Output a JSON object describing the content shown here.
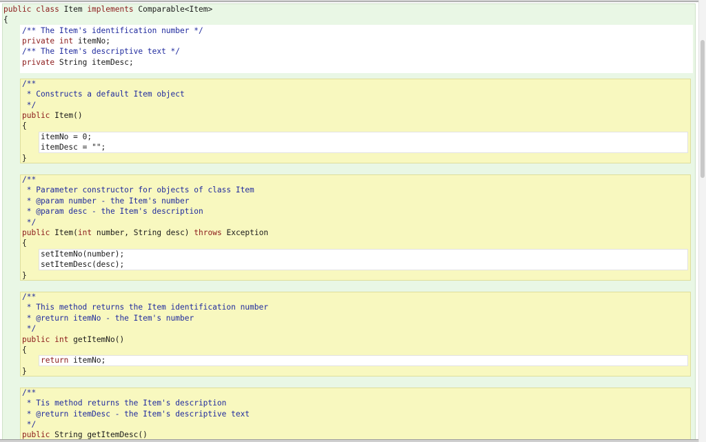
{
  "colors": {
    "keyword": "#8b1a1a",
    "comment": "#1f2a9e",
    "class_bg": "#e9f7e5",
    "method_bg": "#f8f8bf",
    "body_bg": "#ffffff"
  },
  "code": {
    "class_decl_kw1": "public",
    "class_decl_kw2": "class",
    "class_decl_name": "Item",
    "class_decl_kw3": "implements",
    "class_decl_type": "Comparable<Item>",
    "open_brace": "{",
    "close_brace": "}",
    "fields": {
      "c1": "/** The Item's identification number */",
      "f1_kw": "private",
      "f1_type": "int",
      "f1_rest": "itemNo;",
      "c2": "/** The Item's descriptive text */",
      "f2_kw": "private",
      "f2_rest": "String itemDesc;"
    },
    "method1": {
      "doc": [
        "/**",
        " * Constructs a default Item object",
        " */"
      ],
      "sig_kw": "public",
      "sig_rest": "Item()",
      "body": [
        "itemNo = 0;",
        "itemDesc = \"\";"
      ]
    },
    "method2": {
      "doc": [
        "/**",
        " * Parameter constructor for objects of class Item",
        " * @param number - the Item's number",
        " * @param desc - the Item's description",
        " */"
      ],
      "sig_kw": "public",
      "sig_rest1": "Item(",
      "sig_int": "int",
      "sig_rest2": "number, String desc)",
      "sig_throws": "throws",
      "sig_rest3": "Exception",
      "body": [
        "setItemNo(number);",
        "setItemDesc(desc);"
      ]
    },
    "method3": {
      "doc": [
        "/**",
        " * This method returns the Item identification number",
        " * @return itemNo - the Item's number",
        " */"
      ],
      "sig_kw": "public",
      "sig_int": "int",
      "sig_rest": "getItemNo()",
      "body_kw": "return",
      "body_rest": "itemNo;"
    },
    "method4": {
      "doc": [
        "/**",
        " * Tis method returns the Item's description",
        " * @return itemDesc - the Item's descriptive text",
        " */"
      ],
      "sig_kw": "public",
      "sig_rest": "String getItemDesc()"
    }
  }
}
